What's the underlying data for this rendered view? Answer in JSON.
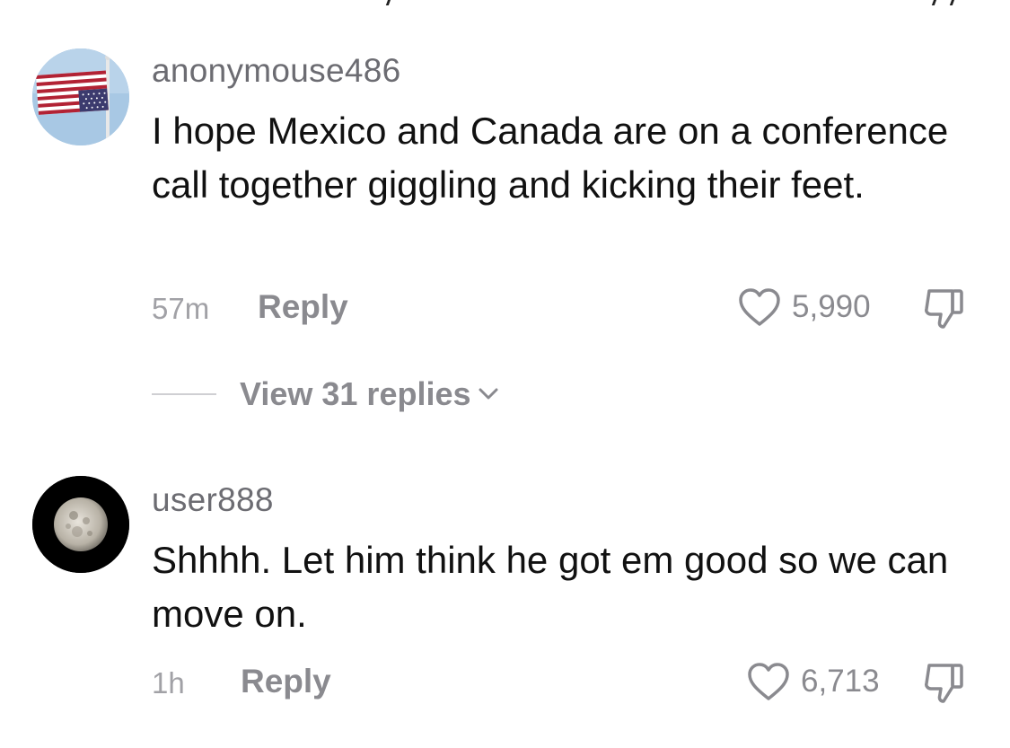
{
  "comments": [
    {
      "username": "anonymouse486",
      "avatar_icon": "upside-down-us-flag-avatar",
      "text": "I hope Mexico and Canada are on a conference call together giggling and kicking their feet.",
      "time": "57m",
      "reply_label": "Reply",
      "likes": "5,990",
      "view_replies_label": "View 31 replies"
    },
    {
      "username": "user888",
      "avatar_icon": "moon-avatar",
      "text": "Shhhh. Let him think he got em good so we can move on.",
      "time": "1h",
      "reply_label": "Reply",
      "likes": "6,713"
    }
  ],
  "colors": {
    "username": "#6c6c72",
    "text": "#111111",
    "meta": "#8a8a8f",
    "timestamp": "#a1a1a6"
  },
  "icons": [
    "heart-icon",
    "dislike-icon",
    "chevron-down-icon"
  ]
}
